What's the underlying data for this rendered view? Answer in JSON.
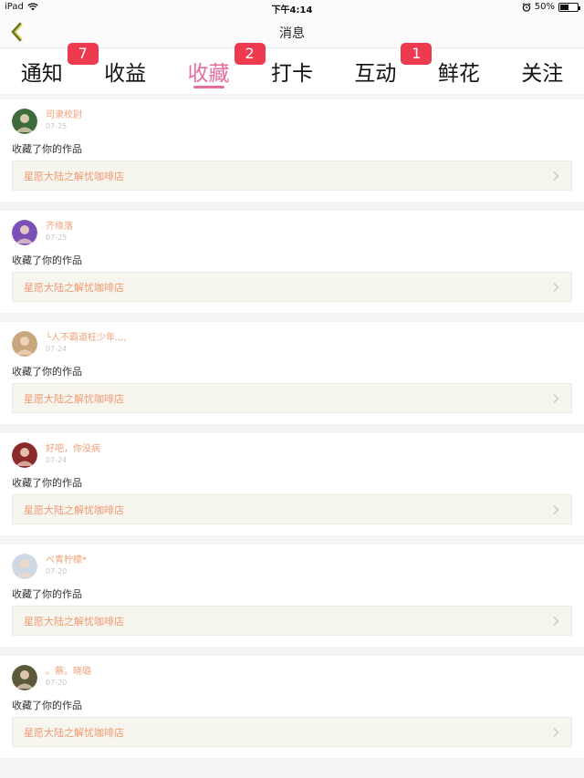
{
  "status_bar": {
    "device": "iPad",
    "time": "下午4:14",
    "battery": "50%",
    "battery_level": 0.5
  },
  "nav": {
    "title": "消息"
  },
  "tabs": [
    {
      "label": "通知",
      "badge": "7",
      "active": false
    },
    {
      "label": "收益",
      "badge": null,
      "active": false
    },
    {
      "label": "收藏",
      "badge": "2",
      "active": true
    },
    {
      "label": "打卡",
      "badge": null,
      "active": false
    },
    {
      "label": "互动",
      "badge": "1",
      "active": false
    },
    {
      "label": "鲜花",
      "badge": null,
      "active": false
    },
    {
      "label": "关注",
      "badge": null,
      "active": false
    }
  ],
  "items": [
    {
      "user": "司隶校尉",
      "date": "07-25",
      "action": "收藏了你的作品",
      "work": "星愿大陆之解忧咖啡店",
      "avatar_color": "#3e6b3a"
    },
    {
      "user": "齐缘落",
      "date": "07-25",
      "action": "收藏了你的作品",
      "work": "星愿大陆之解忧咖啡店",
      "avatar_color": "#7a4fb8"
    },
    {
      "user": "╰人不霸道枉少年.,,,",
      "date": "07-24",
      "action": "收藏了你的作品",
      "work": "星愿大陆之解忧咖啡店",
      "avatar_color": "#c9a77c"
    },
    {
      "user": "好吧，你没病",
      "date": "07-24",
      "action": "收藏了你的作品",
      "work": "星愿大陆之解忧咖啡店",
      "avatar_color": "#8a2a2a"
    },
    {
      "user": "べ青柠檬*",
      "date": "07-20",
      "action": "收藏了你的作品",
      "work": "星愿大陆之解忧咖啡店",
      "avatar_color": "#cfd9e3"
    },
    {
      "user": "。蔡。晓璐",
      "date": "07-20",
      "action": "收藏了你的作品",
      "work": "星愿大陆之解忧咖啡店",
      "avatar_color": "#5a5a3a"
    }
  ]
}
